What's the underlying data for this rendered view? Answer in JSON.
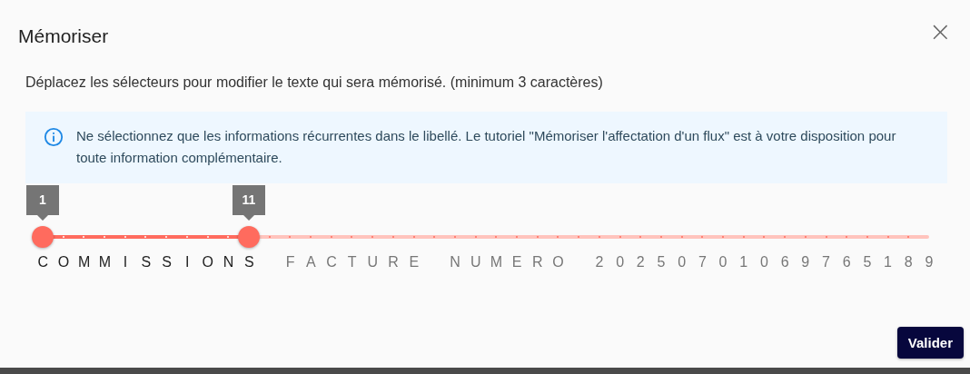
{
  "dialog": {
    "title": "Mémoriser",
    "close": "×",
    "description": "Déplacez les sélecteurs pour modifier le texte qui sera mémorisé. (minimum 3 caractères)",
    "info": "Ne sélectionnez que les informations récurrentes dans le libellé. Le tutoriel \"Mémoriser l'affectation d'un flux\" est à votre disposition pour toute information complémentaire.",
    "slider": {
      "thumbs": [
        {
          "value": "1",
          "level": 0
        },
        {
          "value": "11",
          "level": 0.2326
        }
      ],
      "words": [
        "C O M M I S S I O N S",
        "F A C T U R E",
        "N U M E R O",
        "2 0 2 5 0 7 0 1 0 6 9 7 6 5 1 8 9"
      ]
    },
    "buttons": [
      {
        "label": "Valider"
      }
    ]
  }
}
